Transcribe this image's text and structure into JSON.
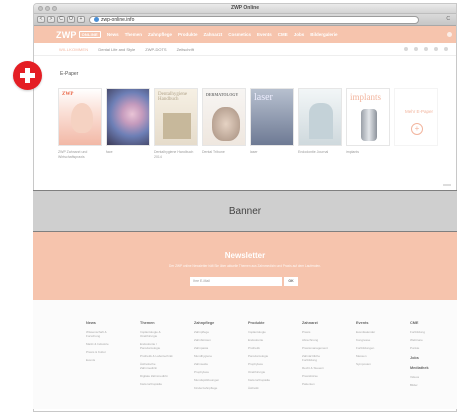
{
  "window": {
    "title": "ZWP Online"
  },
  "toolbar": {
    "buttons": [
      "<",
      ">",
      "C",
      "O",
      "+"
    ],
    "url": "zwp-online.info",
    "url_right": "C"
  },
  "site_nav": {
    "logo": "ZWP",
    "logo_badge": "ONLINE",
    "links": [
      "News",
      "Themen",
      "Zahnpflege",
      "Produkte",
      "Zahnarzt",
      "Cosmetics",
      "Events",
      "CME",
      "Jobs",
      "Bildergalerie"
    ]
  },
  "sub_nav": {
    "welcome": "WILLKOMMEN",
    "links": [
      "Dental Life and Style",
      "ZWP-DOTS",
      "Zeitschrift"
    ]
  },
  "epaper": {
    "title": "E-Paper",
    "covers": [
      {
        "name": "ZWP",
        "caption": "ZWP Zahnarzt und Wirtschaftspraxis"
      },
      {
        "name": "",
        "caption": "face"
      },
      {
        "name": "Dentalhygiene Handbuch",
        "caption": "Dentalhygiene Handbuch 2014"
      },
      {
        "name": "DERMATOLOGY",
        "caption": "Dental Tribune"
      },
      {
        "name": "laser",
        "caption": "laser"
      },
      {
        "name": "",
        "caption": "Endodontie Journal"
      },
      {
        "name": "implants",
        "caption": "implants"
      }
    ],
    "more_label": "Mehr E-Paper",
    "more_icon": "+"
  },
  "banner": {
    "label": "Banner"
  },
  "newsletter": {
    "title": "Newsletter",
    "text": "Der ZWP online Newsletter hält Sie über aktuelle Themen aus Zahnmedizin und Praxis auf dem Laufenden.",
    "input_placeholder": "Ihre E-Mail",
    "button_label": "OK"
  },
  "footer": {
    "columns": [
      {
        "head": "News",
        "items": [
          "Wissenschaft & Forschung",
          "Markt & Industrie",
          "Praxis & Kultur",
          "Events"
        ]
      },
      {
        "head": "Themen",
        "items": [
          "Implantologie & Oralchirurgie",
          "Endodontie / Parodontologie",
          "Prothetik & Labortechnik",
          "Ästhetische Zahnmedizin",
          "Digitale Zahnmedizin",
          "Kieferorthopädie"
        ]
      },
      {
        "head": "Zahnpflege",
        "items": [
          "Zahnpflege",
          "Zahnbürsten",
          "Zahnpasta",
          "Mundhygiene",
          "Zahnseide",
          "Prophylaxe",
          "Mundspüllösungen",
          "Kinderzahnpflege"
        ]
      },
      {
        "head": "Produkte",
        "items": [
          "Implantologie",
          "Endodontie",
          "Prothetik",
          "Parodontologie",
          "Prophylaxe",
          "Oralchirurgie",
          "Kieferorthopädie",
          "Ästhetik"
        ]
      },
      {
        "head": "Zahnarzt",
        "items": [
          "Praxis",
          "Abrechnung",
          "Praxismanagement",
          "Zahnärztliche Fortbildung",
          "Recht & Steuern",
          "Praxisbörse",
          "Patienten"
        ]
      },
      {
        "head": "Events",
        "items": [
          "Eventkalender",
          "Kongresse",
          "Fortbildungen",
          "Messen",
          "Symposien"
        ]
      },
      {
        "head": "CME",
        "items": [
          "Fortbildung",
          "Webinare",
          "Punkte"
        ]
      }
    ],
    "extra": {
      "jobs": "Jobs",
      "mediathek": "Mediathek",
      "mediathek_items": [
        "Videos",
        "Bilder"
      ]
    }
  },
  "overlay": {
    "badge_icon": "plus-icon"
  }
}
